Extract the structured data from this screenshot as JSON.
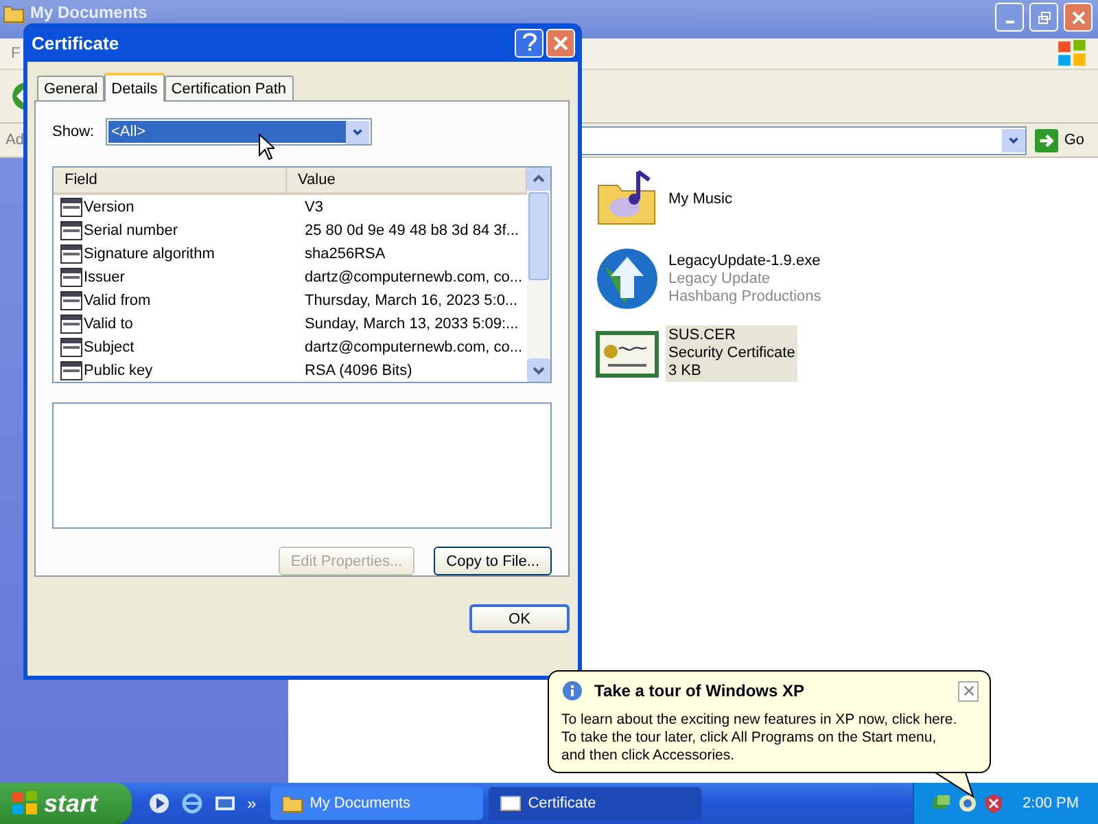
{
  "explorer": {
    "title": "My Documents",
    "menu_fragment": "F",
    "address_label": "Ad",
    "go_button": "Go",
    "items": [
      {
        "kind": "folder",
        "name": "My Music",
        "selected": false
      },
      {
        "kind": "installer",
        "name": "LegacyUpdate-1.9.exe",
        "lines": [
          "Legacy Update",
          "Hashbang Productions"
        ],
        "selected": false
      },
      {
        "kind": "certificate",
        "name": "SUS.CER",
        "lines": [
          "Security Certificate",
          "3 KB"
        ],
        "selected": true
      }
    ]
  },
  "dialog": {
    "title": "Certificate",
    "tabs": [
      {
        "label": "General",
        "selected": false
      },
      {
        "label": "Details",
        "selected": true
      },
      {
        "label": "Certification Path",
        "selected": false
      }
    ],
    "show_label": "Show:",
    "show_value": "<All>",
    "columns": [
      "Field",
      "Value"
    ],
    "rows": [
      {
        "field": "Version",
        "value": "V3"
      },
      {
        "field": "Serial number",
        "value": "25 80 0d 9e 49 48 b8 3d 84 3f..."
      },
      {
        "field": "Signature algorithm",
        "value": "sha256RSA"
      },
      {
        "field": "Issuer",
        "value": "dartz@computernewb.com, co..."
      },
      {
        "field": "Valid from",
        "value": "Thursday, March 16, 2023 5:0..."
      },
      {
        "field": "Valid to",
        "value": "Sunday, March 13, 2033 5:09:..."
      },
      {
        "field": "Subject",
        "value": "dartz@computernewb.com, co..."
      },
      {
        "field": "Public key",
        "value": "RSA (4096 Bits)"
      }
    ],
    "buttons": [
      {
        "label": "Edit Properties...",
        "disabled": true
      },
      {
        "label": "Copy to File...",
        "disabled": false
      }
    ],
    "ok": "OK"
  },
  "balloon": {
    "title": "Take a tour of Windows XP",
    "lines": [
      "To learn about the exciting new features in XP now, click here.",
      "To take the tour later, click All Programs on the Start menu,",
      "and then click Accessories."
    ]
  },
  "taskbar": {
    "start": "start",
    "more": "»",
    "tasks": [
      {
        "kind": "folder",
        "label": "My Documents",
        "selected": false
      },
      {
        "kind": "certificate",
        "label": "Certificate",
        "selected": true
      }
    ],
    "clock": "2:00 PM"
  }
}
